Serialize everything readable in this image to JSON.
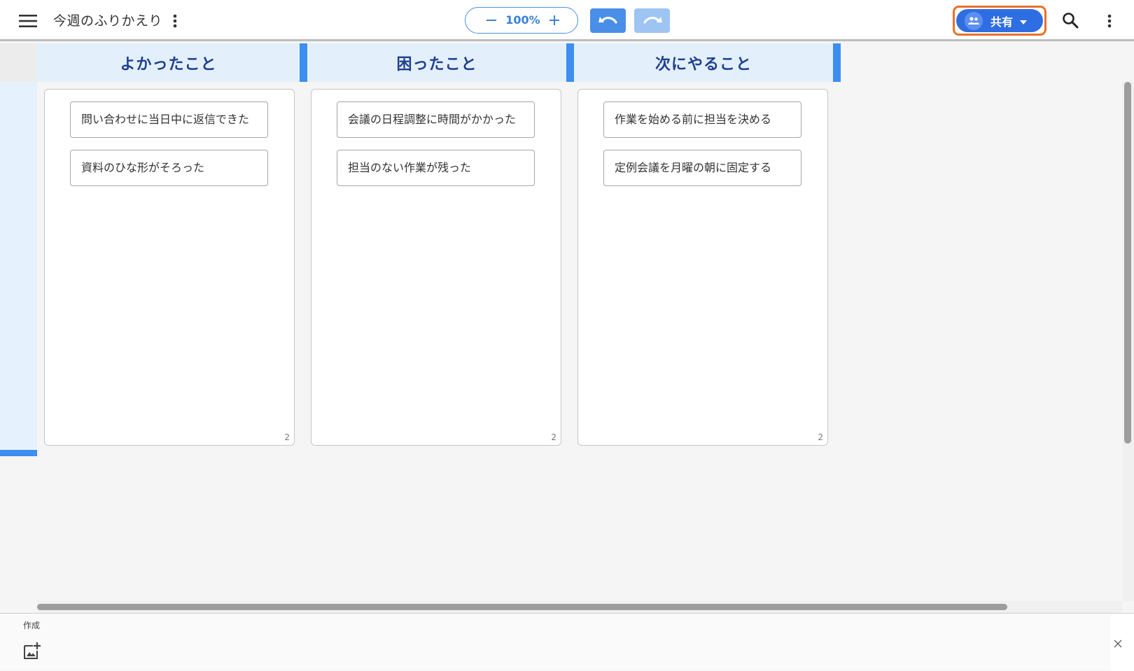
{
  "header": {
    "document_title": "今週のふりかえり",
    "zoom_value": "100%",
    "zoom_minus_icon": "minus-icon",
    "zoom_plus_icon": "plus-icon",
    "share_label": "共有",
    "share_icon": "people-icon",
    "accent_color": "#4a8fe7",
    "share_outline_color": "#e8702a"
  },
  "board": {
    "columns": [
      {
        "title": "よかったこと",
        "cards": [
          "問い合わせに当日中に返信できた",
          "資料のひな形がそろった"
        ],
        "count": "2"
      },
      {
        "title": "困ったこと",
        "cards": [
          "会議の日程調整に時間がかかった",
          "担当のない作業が残った"
        ],
        "count": "2"
      },
      {
        "title": "次にやること",
        "cards": [
          "作業を始める前に担当を決める",
          "定例会議を月曜の朝に固定する"
        ],
        "count": "2"
      }
    ]
  },
  "bottom_panel": {
    "label": "作成",
    "add_icon": "add-image-icon",
    "close_icon": "close-icon"
  }
}
